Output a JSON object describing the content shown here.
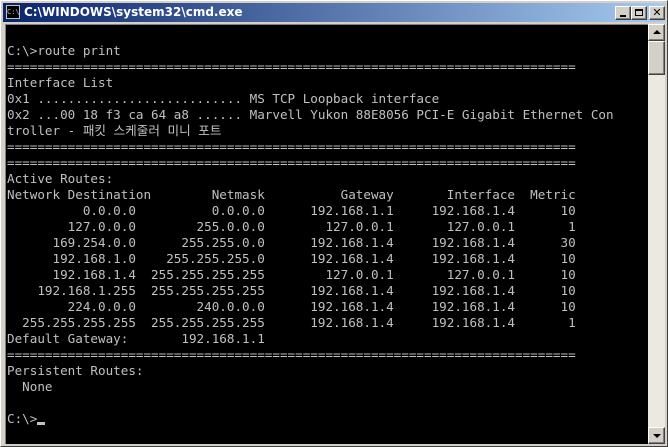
{
  "window": {
    "title": "C:\\WINDOWS\\system32\\cmd.exe",
    "icon": "cmd-icon",
    "controls": {
      "minimize": "minimize-icon",
      "maximize": "maximize-icon",
      "close": "✕"
    }
  },
  "console": {
    "lines": [
      "C:\\>route print",
      "===========================================================================",
      "Interface List",
      "0x1 ........................... MS TCP Loopback interface",
      "0x2 ...00 18 f3 ca 64 a8 ...... Marvell Yukon 88E8056 PCI-E Gigabit Ethernet Con",
      "troller - 패킷 스케줄러 미니 포트",
      "===========================================================================",
      "===========================================================================",
      "Active Routes:",
      "Network Destination        Netmask          Gateway       Interface  Metric",
      "          0.0.0.0          0.0.0.0      192.168.1.1     192.168.1.4      10",
      "        127.0.0.0        255.0.0.0        127.0.0.1       127.0.0.1       1",
      "      169.254.0.0      255.255.0.0      192.168.1.4     192.168.1.4      30",
      "      192.168.1.0    255.255.255.0      192.168.1.4     192.168.1.4      10",
      "      192.168.1.4  255.255.255.255        127.0.0.1       127.0.0.1      10",
      "    192.168.1.255  255.255.255.255      192.168.1.4     192.168.1.4      10",
      "        224.0.0.0        240.0.0.0      192.168.1.4     192.168.1.4      10",
      "  255.255.255.255  255.255.255.255      192.168.1.4     192.168.1.4       1",
      "Default Gateway:       192.168.1.1",
      "===========================================================================",
      "Persistent Routes:",
      "  None",
      "",
      "C:\\>"
    ]
  },
  "scrollbar": {
    "position": 0
  }
}
